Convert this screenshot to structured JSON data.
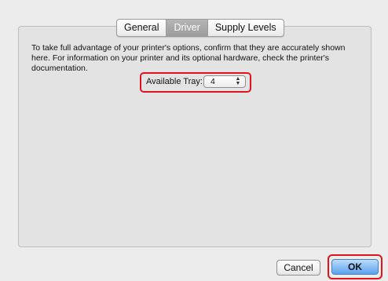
{
  "tabs": [
    {
      "label": "General",
      "active": false
    },
    {
      "label": "Driver",
      "active": true
    },
    {
      "label": "Supply Levels",
      "active": false
    }
  ],
  "description": "To take full advantage of your printer's options, confirm that they are accurately shown here. For information on your printer and its optional hardware, check the printer's documentation.",
  "tray": {
    "label": "Available Tray:",
    "value": "4",
    "arrows_icon": "up-down-chevron-icon"
  },
  "buttons": {
    "cancel_label": "Cancel",
    "ok_label": "OK"
  },
  "colors": {
    "highlight": "#e0141e",
    "active_tab": "#a8a8a8",
    "default_button": "#5aa2ee"
  }
}
